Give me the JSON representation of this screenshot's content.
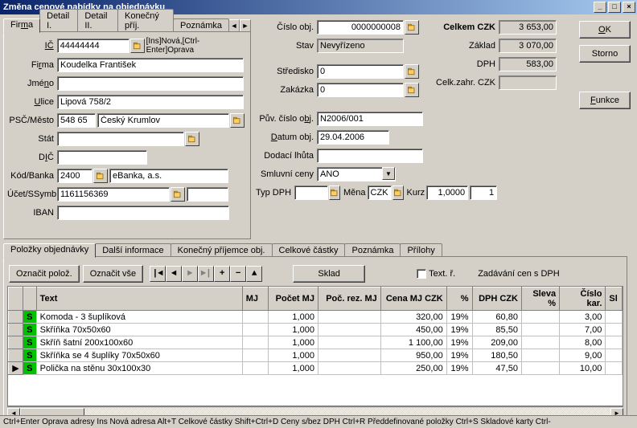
{
  "window": {
    "title": "Změna cenové nabídky na objednávku"
  },
  "sideButtons": {
    "ok": "OK",
    "storno": "Storno",
    "funkce": "Funkce"
  },
  "mainTabs": {
    "firma": "Firma",
    "detail1": "Detail I.",
    "detail2": "Detail II.",
    "konecny": "Konečný příj.",
    "poznamka": "Poznámka"
  },
  "firm": {
    "ic_label": "IČ",
    "ic": "44444444",
    "ic_hint": "[Ins]Nová,[Ctrl-Enter]Oprava",
    "firma_label": "Firma",
    "firma": "Koudelka František",
    "jmeno_label": "Jméno",
    "jmeno": "",
    "ulice_label": "Ulice",
    "ulice": "Lipová 758/2",
    "pscmesto_label": "PSČ/Město",
    "psc": "548 65",
    "mesto": "Český Krumlov",
    "stat_label": "Stát",
    "stat": "",
    "dic_label": "DIČ",
    "dic": "",
    "kodbanka_label": "Kód/Banka",
    "bankkod": "2400",
    "banka": "eBanka, a.s.",
    "ucet_label": "Účet/SSymb",
    "ucet": "1161156369",
    "ssymb": "",
    "iban_label": "IBAN",
    "iban": ""
  },
  "order": {
    "cislo_label": "Číslo obj.",
    "cislo": "0000000008",
    "stav_label": "Stav",
    "stav": "Nevyřízeno",
    "stredisko_label": "Středisko",
    "stredisko": "0",
    "zakazka_label": "Zakázka",
    "zakazka": "0",
    "puvcislo_label": "Pův. číslo obj.",
    "puvcislo": "N2006/001",
    "datum_label": "Datum obj.",
    "datum": "29.04.2006",
    "dodaci_label": "Dodací lhůta",
    "dodaci": "",
    "smluvni_label": "Smluvní ceny",
    "smluvni": "ANO",
    "typdph_label": "Typ DPH",
    "typdph": "",
    "mena_label": "Měna",
    "mena": "CZK",
    "kurz_label": "Kurz",
    "kurz": "1,0000",
    "kurz2": "1"
  },
  "totals": {
    "celkem_label": "Celkem CZK",
    "celkem": "3 653,00",
    "zaklad_label": "Základ",
    "zaklad": "3 070,00",
    "dph_label": "DPH",
    "dph": "583,00",
    "celkzahr_label": "Celk.zahr. CZK",
    "celkzahr": ""
  },
  "innerTabs": {
    "polozky": "Položky objednávky",
    "dalsi": "Další informace",
    "konecny": "Konečný příjemce obj.",
    "celkove": "Celkové částky",
    "poznamka": "Poznámka",
    "prilohy": "Přílohy"
  },
  "toolbar": {
    "oznacit": "Označit polož.",
    "oznacit_vse": "Označit vše",
    "sklad": "Sklad",
    "text_r": "Text. ř.",
    "zadavani": "Zadávání cen s DPH"
  },
  "grid": {
    "cols": {
      "text": "Text",
      "mj": "MJ",
      "pocetmj": "Počet MJ",
      "pocrez": "Poč. rez. MJ",
      "cenamj": "Cena MJ CZK",
      "pct": "%",
      "dphczk": "DPH CZK",
      "sleva": "Sleva %",
      "cislokar": "Číslo kar.",
      "sl": "Sl"
    },
    "rows": [
      {
        "s": "S",
        "text": "Komoda - 3 šuplíková",
        "mj": "",
        "pocet": "1,000",
        "rez": "",
        "cena": "320,00",
        "pct": "19%",
        "dph": "60,80",
        "sleva": "",
        "kar": "3,00"
      },
      {
        "s": "S",
        "text": "Skříňka  70x50x60",
        "mj": "",
        "pocet": "1,000",
        "rez": "",
        "cena": "450,00",
        "pct": "19%",
        "dph": "85,50",
        "sleva": "",
        "kar": "7,00"
      },
      {
        "s": "S",
        "text": "Skříň šatní 200x100x60",
        "mj": "",
        "pocet": "1,000",
        "rez": "",
        "cena": "1 100,00",
        "pct": "19%",
        "dph": "209,00",
        "sleva": "",
        "kar": "8,00"
      },
      {
        "s": "S",
        "text": "Skříňka se 4 šuplíky 70x50x60",
        "mj": "",
        "pocet": "1,000",
        "rez": "",
        "cena": "950,00",
        "pct": "19%",
        "dph": "180,50",
        "sleva": "",
        "kar": "9,00"
      },
      {
        "s": "S",
        "text": "Polička na stěnu 30x100x30",
        "mj": "",
        "pocet": "1,000",
        "rez": "",
        "cena": "250,00",
        "pct": "19%",
        "dph": "47,50",
        "sleva": "",
        "kar": "10,00"
      }
    ]
  },
  "status": "Ctrl+Enter Oprava adresy  Ins Nová adresa  Alt+T Celkové částky  Shift+Ctrl+D Ceny s/bez DPH    Ctrl+R Předdefinované položky  Ctrl+S Skladové karty  Ctrl-"
}
